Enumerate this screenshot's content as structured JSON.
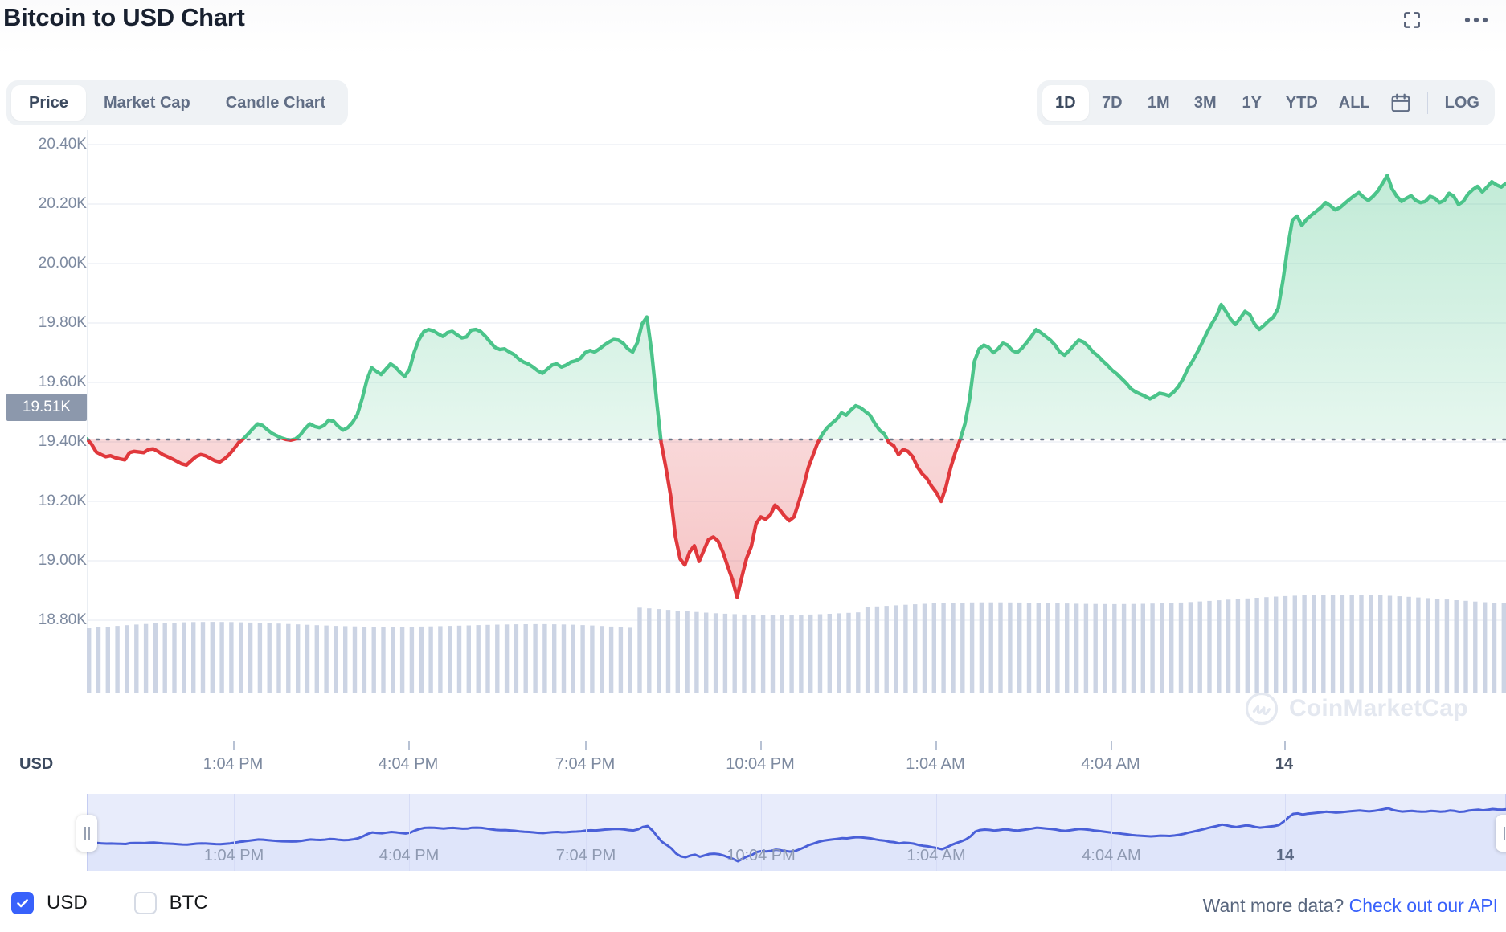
{
  "header": {
    "title": "Bitcoin to USD Chart",
    "expand_icon": "fullscreen-expand-icon",
    "menu_icon": "more-options-icon"
  },
  "tabs": [
    {
      "label": "Price",
      "active": true
    },
    {
      "label": "Market Cap",
      "active": false
    },
    {
      "label": "Candle Chart",
      "active": false
    }
  ],
  "ranges": [
    {
      "label": "1D",
      "active": true
    },
    {
      "label": "7D",
      "active": false
    },
    {
      "label": "1M",
      "active": false
    },
    {
      "label": "3M",
      "active": false
    },
    {
      "label": "1Y",
      "active": false
    },
    {
      "label": "YTD",
      "active": false
    },
    {
      "label": "ALL",
      "active": false
    }
  ],
  "calendar_icon": "calendar-icon",
  "log_label": "LOG",
  "currency_axis_label": "USD",
  "watermark": {
    "text": "CoinMarketCap",
    "logo": "coinmarketcap-logo-icon"
  },
  "current_price_label": "19.51K",
  "currency_toggles": [
    {
      "label": "USD",
      "checked": true
    },
    {
      "label": "BTC",
      "checked": false
    }
  ],
  "footer": {
    "note": "Want more data?",
    "link": "Check out our API"
  },
  "colors": {
    "up": "#4bc48a",
    "down": "#e0383c",
    "accent": "#3861fb",
    "volume": "#ccd4e4",
    "axis_text": "#7d8aa0",
    "badge": "#8c98ac"
  },
  "chart_data": {
    "type": "area",
    "title": "Bitcoin to USD Chart",
    "xlabel": "",
    "ylabel": "USD",
    "ylim": [
      18700,
      20500
    ],
    "yticks": [
      18800,
      19000,
      19200,
      19400,
      19600,
      19800,
      20000,
      20200,
      20400
    ],
    "ytick_labels": [
      "18.80K",
      "19.00K",
      "19.20K",
      "19.40K",
      "19.60K",
      "19.80K",
      "20.00K",
      "20.20K",
      "20.40K"
    ],
    "xtick_labels": [
      "1:04 PM",
      "4:04 PM",
      "7:04 PM",
      "10:04 PM",
      "1:04 AM",
      "4:04 AM",
      "14"
    ],
    "xtick_positions": [
      0.1,
      0.23,
      0.35,
      0.47,
      0.58,
      0.7,
      0.82
    ],
    "reference_line": 19510,
    "reference_label": "19.51K",
    "grid": true,
    "legend": "none",
    "series": [
      {
        "name": "BTC price (USD)",
        "color_up": "#4bc48a",
        "color_down": "#e0383c",
        "values": [
          19512,
          19495,
          19470,
          19462,
          19455,
          19458,
          19452,
          19448,
          19445,
          19468,
          19472,
          19470,
          19468,
          19478,
          19480,
          19472,
          19462,
          19455,
          19448,
          19440,
          19432,
          19428,
          19442,
          19455,
          19462,
          19458,
          19450,
          19442,
          19438,
          19448,
          19462,
          19480,
          19500,
          19512,
          19528,
          19545,
          19560,
          19555,
          19542,
          19530,
          19522,
          19515,
          19510,
          19508,
          19512,
          19525,
          19545,
          19560,
          19552,
          19548,
          19555,
          19572,
          19568,
          19552,
          19540,
          19548,
          19565,
          19590,
          19640,
          19700,
          19740,
          19728,
          19718,
          19735,
          19752,
          19742,
          19725,
          19712,
          19735,
          19790,
          19830,
          19855,
          19862,
          19858,
          19848,
          19840,
          19852,
          19856,
          19845,
          19835,
          19838,
          19860,
          19862,
          19855,
          19840,
          19822,
          19805,
          19798,
          19800,
          19790,
          19782,
          19768,
          19758,
          19752,
          19742,
          19730,
          19722,
          19735,
          19748,
          19752,
          19742,
          19748,
          19758,
          19762,
          19770,
          19788,
          19795,
          19790,
          19800,
          19812,
          19822,
          19830,
          19828,
          19818,
          19800,
          19790,
          19820,
          19880,
          19902,
          19790,
          19640,
          19500,
          19420,
          19330,
          19200,
          19128,
          19108,
          19150,
          19170,
          19120,
          19155,
          19190,
          19198,
          19185,
          19150,
          19105,
          19062,
          19005,
          19070,
          19130,
          19168,
          19240,
          19262,
          19255,
          19268,
          19300,
          19285,
          19265,
          19250,
          19262,
          19310,
          19360,
          19420,
          19460,
          19500,
          19528,
          19548,
          19562,
          19575,
          19595,
          19588,
          19605,
          19618,
          19612,
          19600,
          19588,
          19562,
          19540,
          19528,
          19500,
          19490,
          19462,
          19478,
          19472,
          19455,
          19422,
          19400,
          19385,
          19360,
          19340,
          19312,
          19358,
          19420,
          19470,
          19510,
          19560,
          19640,
          19760,
          19800,
          19812,
          19805,
          19788,
          19800,
          19818,
          19812,
          19795,
          19788,
          19802,
          19820,
          19840,
          19862,
          19852,
          19840,
          19828,
          19812,
          19790,
          19780,
          19795,
          19812,
          19828,
          19822,
          19808,
          19790,
          19778,
          19762,
          19748,
          19732,
          19720,
          19705,
          19690,
          19672,
          19662,
          19655,
          19648,
          19640,
          19648,
          19658,
          19655,
          19650,
          19662,
          19680,
          19705,
          19738,
          19762,
          19790,
          19820,
          19852,
          19880,
          19905,
          19942,
          19920,
          19895,
          19878,
          19898,
          19920,
          19910,
          19880,
          19862,
          19875,
          19890,
          19902,
          19930,
          20018,
          20125,
          20212,
          20225,
          20195,
          20215,
          20228,
          20240,
          20252,
          20268,
          20258,
          20245,
          20252,
          20265,
          20278,
          20290,
          20300,
          20285,
          20275,
          20288,
          20305,
          20330,
          20355,
          20312,
          20288,
          20272,
          20282,
          20290,
          20275,
          20268,
          20272,
          20288,
          20282,
          20268,
          20275,
          20298,
          20288,
          20262,
          20272,
          20295,
          20310,
          20320,
          20302,
          20318,
          20335,
          20325,
          20318,
          20330
        ]
      }
    ],
    "volume": {
      "name": "Volume",
      "color": "#ccd4e4",
      "note": "uniform light bars along the bottom, slight rise after the mid-session drop"
    },
    "navigator": {
      "color": "#4a60d8",
      "fill": "#e4e9fb",
      "selection": "full-range"
    }
  }
}
